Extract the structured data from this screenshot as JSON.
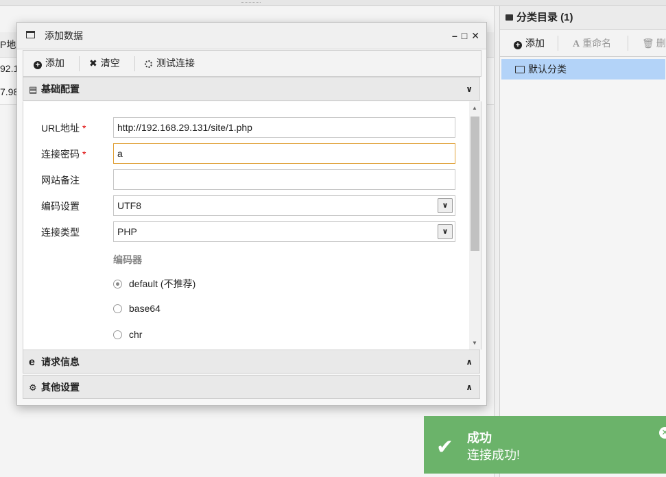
{
  "background": {
    "column_header": "P地",
    "row_values": [
      "92.1",
      "7.98"
    ]
  },
  "category_panel": {
    "title": "分类目录 (1)",
    "toolbar": {
      "add": "添加",
      "rename": "重命名",
      "delete": "删除"
    },
    "items": [
      {
        "label": "默认分类"
      }
    ]
  },
  "dialog": {
    "title": "添加数据",
    "controls": {
      "minimize": "–",
      "maximize": "□",
      "close": "✕"
    },
    "toolbar": {
      "add": "添加",
      "clear": "清空",
      "test": "测试连接"
    },
    "sections": {
      "basic": "基础配置",
      "request": "请求信息",
      "other": "其他设置"
    },
    "form": {
      "url": {
        "label": "URL地址",
        "required_mark": "*",
        "value": "http://192.168.29.131/site/1.php"
      },
      "password": {
        "label": "连接密码",
        "required_mark": "*",
        "value": "a"
      },
      "note": {
        "label": "网站备注",
        "value": ""
      },
      "encoding": {
        "label": "编码设置",
        "value": "UTF8"
      },
      "type": {
        "label": "连接类型",
        "value": "PHP"
      },
      "encoder": {
        "label": "编码器",
        "options": [
          {
            "label": "default (不推荐)",
            "selected": true
          },
          {
            "label": "base64",
            "selected": false
          },
          {
            "label": "chr",
            "selected": false
          }
        ]
      }
    }
  },
  "toast": {
    "title": "成功",
    "message": "连接成功!",
    "color": "#6bb36a"
  }
}
